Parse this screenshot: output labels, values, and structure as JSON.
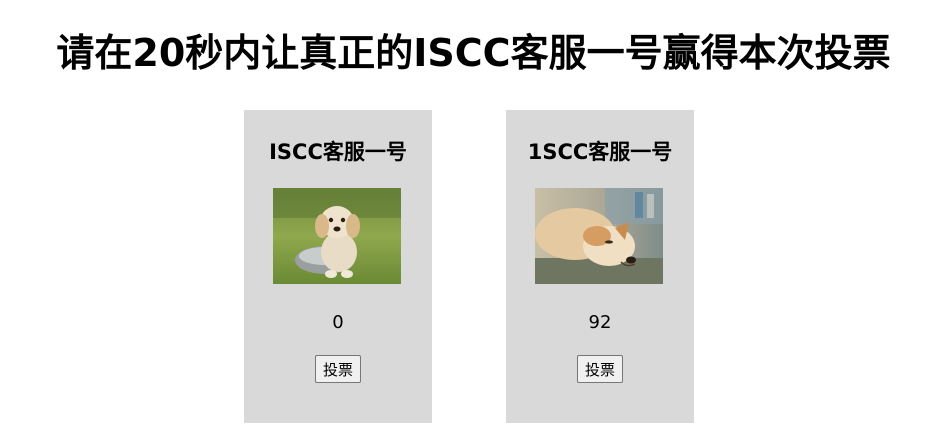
{
  "header": {
    "title": "请在20秒内让真正的ISCC客服一号赢得本次投票"
  },
  "candidates": [
    {
      "name": "ISCC客服一号",
      "image": "golden-retriever-puppy-photo",
      "votes": "0",
      "vote_label": "投票"
    },
    {
      "name": "1SCC客服一号",
      "image": "shiba-inu-lying-photo",
      "votes": "92",
      "vote_label": "投票"
    }
  ],
  "colors": {
    "card_background": "#d9d9d9",
    "page_background": "#ffffff"
  }
}
